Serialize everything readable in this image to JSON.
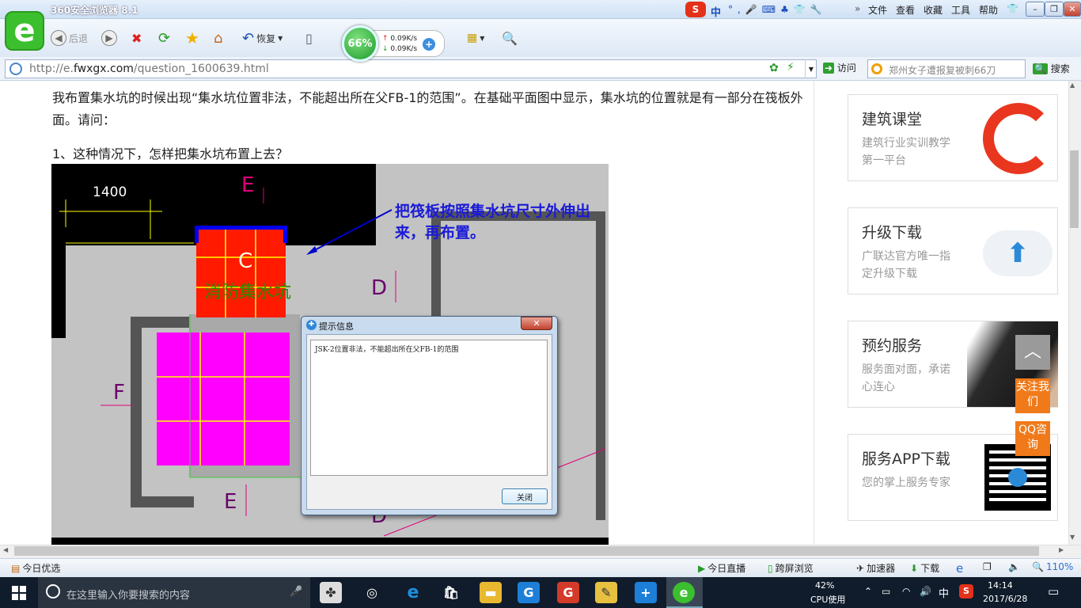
{
  "browser": {
    "title": "360安全浏览器 8.1",
    "menu": [
      "文件",
      "查看",
      "收藏",
      "工具",
      "帮助"
    ],
    "ime": "中",
    "toolbar": {
      "back": "后退",
      "restore": "恢复"
    },
    "speed": {
      "percent": "66%",
      "up": "0.09K/s",
      "down": "0.09K/s"
    },
    "url_prefix": "http://e.",
    "url_domain": "fwxgx.com",
    "url_path": "/question_1600639.html",
    "go_label": "访问",
    "search_text": "郑州女子遭报复被刺66刀",
    "search_button": "搜索"
  },
  "article": {
    "question": "我布置集水坑的时候出现“集水坑位置非法，不能超出所在父FB-1的范围”。在基础平面图中显示，集水坑的位置就是有一部分在筏板外面。请问：",
    "item1": "1、这种情况下，怎样把集水坑布置上去？",
    "cad": {
      "dim": "1400",
      "labels": {
        "e_top": "E",
        "c": "C",
        "d_right": "D",
        "f": "F",
        "e_bottom": "E",
        "d_bottom": "D"
      },
      "pit_label": "消防集水坑",
      "annotation": "把筏板按照集水坑尺寸外伸出来，再布置。"
    },
    "dialog": {
      "title": "提示信息",
      "message": "JSK-2位置非法，不能超出所在父FB-1的范围",
      "close": "关闭"
    }
  },
  "sidebar": [
    {
      "title": "建筑课堂",
      "sub": "建筑行业实训教学第一平台",
      "icon": "brand-logo-icon"
    },
    {
      "title": "升级下载",
      "sub": "广联达官方唯一指定升级下载",
      "icon": "cloud-upload-icon"
    },
    {
      "title": "预约服务",
      "sub": "服务面对面，承诺心连心",
      "icon": "handshake-photo"
    },
    {
      "title": "服务APP下载",
      "sub": "您的掌上服务专家",
      "icon": "qr-code-icon"
    }
  ],
  "float": {
    "follow": "关注我们",
    "qq": "QQ咨询"
  },
  "status": {
    "left": "今日优选",
    "live": "今日直播",
    "cross": "跨屏浏览",
    "accel": "加速器",
    "download": "下载",
    "zoom": "110%"
  },
  "taskbar": {
    "search": "在这里输入你要搜索的内容",
    "cpu_percent": "42%",
    "cpu_label": "CPU使用",
    "ime": "中",
    "time": "14:14",
    "date": "2017/6/28"
  },
  "colors": {
    "accent_blue": "#1a3fc4",
    "pit_red": "#ff1a00",
    "pit_magenta": "#ff00ff",
    "float_orange": "#f07a1a"
  }
}
